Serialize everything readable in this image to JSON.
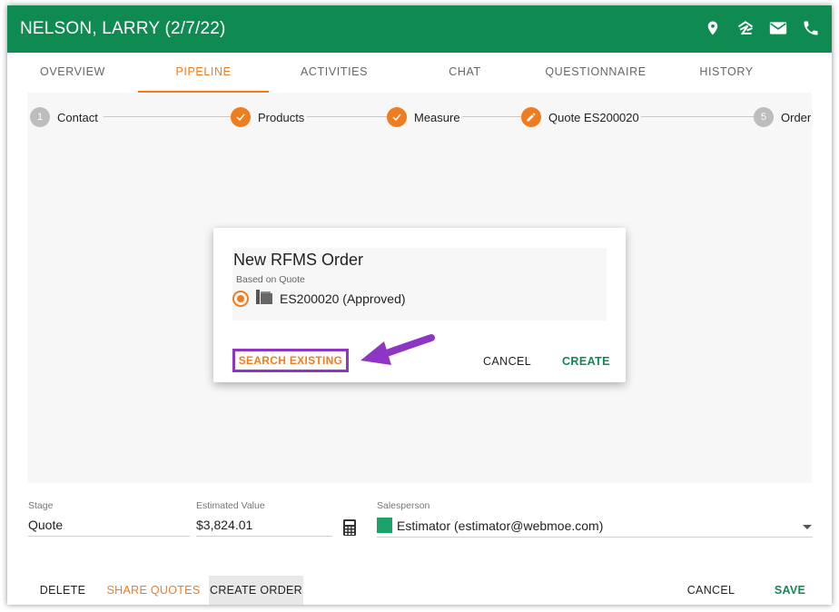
{
  "header": {
    "title": "NELSON, LARRY (2/7/22)",
    "icons": [
      "map-pin-icon",
      "zillow-icon",
      "mail-icon",
      "phone-icon"
    ]
  },
  "tabs": [
    {
      "label": "OVERVIEW",
      "active": false
    },
    {
      "label": "PIPELINE",
      "active": true
    },
    {
      "label": "ACTIVITIES",
      "active": false
    },
    {
      "label": "CHAT",
      "active": false
    },
    {
      "label": "QUESTIONNAIRE",
      "active": false
    },
    {
      "label": "HISTORY",
      "active": false
    }
  ],
  "stepper": [
    {
      "marker": "1",
      "label": "Contact",
      "state": "pending"
    },
    {
      "marker": "check",
      "label": "Products",
      "state": "done"
    },
    {
      "marker": "check",
      "label": "Measure",
      "state": "done"
    },
    {
      "marker": "edit",
      "label": "Quote ES200020",
      "state": "editing"
    },
    {
      "marker": "5",
      "label": "Order",
      "state": "pending"
    }
  ],
  "dialog": {
    "title": "New RFMS Order",
    "subtitle": "Based on Quote",
    "quote_option": "ES200020 (Approved)",
    "search_existing": "SEARCH EXISTING",
    "cancel": "CANCEL",
    "create": "CREATE"
  },
  "fields": {
    "stage_label": "Stage",
    "stage_value": "Quote",
    "estimated_label": "Estimated Value",
    "estimated_value": "$3,824.01",
    "salesperson_label": "Salesperson",
    "salesperson_value": "Estimator (estimator@webmoe.com)"
  },
  "footer": {
    "delete": "DELETE",
    "share_quotes": "SHARE QUOTES",
    "create_order": "CREATE ORDER",
    "cancel": "CANCEL",
    "save": "SAVE"
  },
  "colors": {
    "brand_green": "#0f8a50",
    "accent_orange": "#ef7d20",
    "highlight_purple": "#8e35c5"
  }
}
